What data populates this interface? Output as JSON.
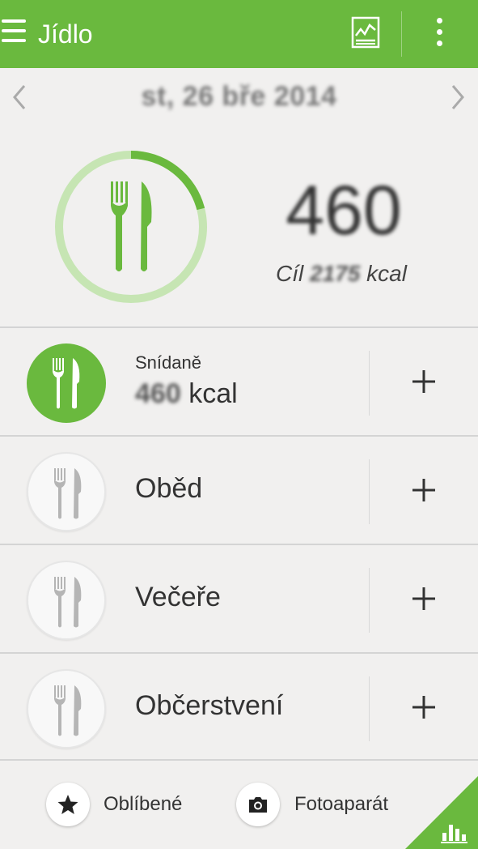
{
  "appbar": {
    "title": "Jídlo",
    "menu_icon": "hamburger-menu-icon",
    "chart_icon": "chart-report-icon",
    "overflow_icon": "vertical-dots-icon",
    "color": "#6ab93e"
  },
  "date_nav": {
    "date": "st, 26 bře 2014",
    "prev_icon": "chevron-left-icon",
    "next_icon": "chevron-right-icon"
  },
  "summary": {
    "consumed": "460",
    "goal_prefix": "Cíl",
    "goal_value": "2175",
    "goal_unit": "kcal",
    "progress_fraction": 0.21,
    "ring_color": "#6ab93e",
    "ring_track_color": "#c6e5b3"
  },
  "meals": [
    {
      "name": "Snídaně",
      "kcal": "460",
      "unit": "kcal",
      "active": true
    },
    {
      "name": "Oběd",
      "active": false
    },
    {
      "name": "Večeře",
      "active": false
    },
    {
      "name": "Občerstvení",
      "active": false
    }
  ],
  "add_label": "+",
  "bottom": {
    "favorites_label": "Oblíbené",
    "favorites_icon": "star-icon",
    "camera_label": "Fotoaparát",
    "camera_icon": "camera-icon",
    "corner_icon": "bar-chart-icon"
  }
}
